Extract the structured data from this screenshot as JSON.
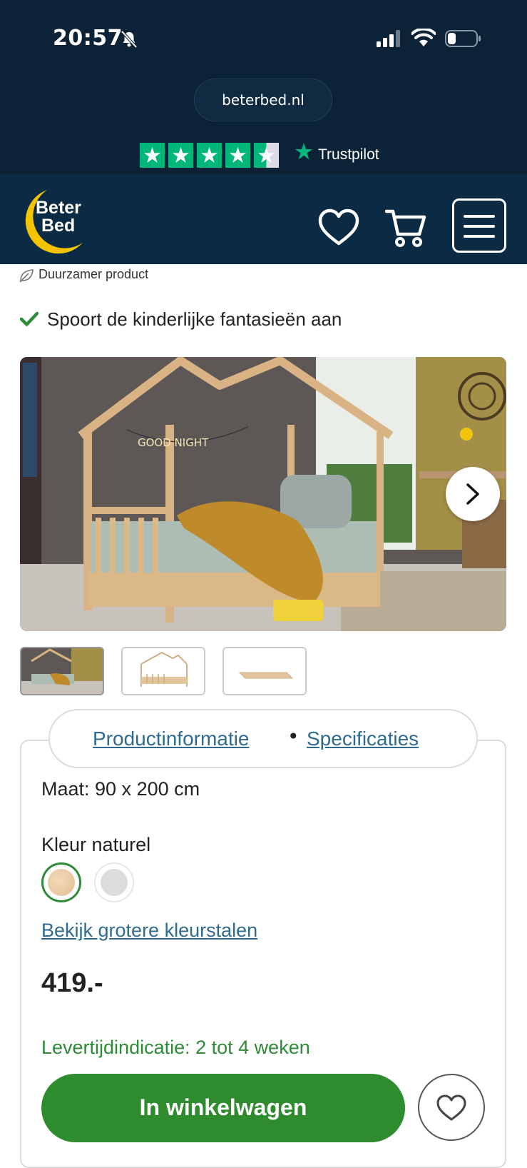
{
  "status_bar": {
    "time": "20:57"
  },
  "browser": {
    "url": "beterbed.nl"
  },
  "trustpilot": {
    "label": "Trustpilot",
    "rating": 4.5,
    "max": 5
  },
  "nav": {
    "logo_line1": "Beter",
    "logo_line2": "Bed"
  },
  "product": {
    "sustainable_label": "Duurzamer product",
    "usp": "Spoort de kinderlijke fantasieën aan",
    "hero_banner_text": "GOOD NIGHT"
  },
  "tabs": {
    "info": "Productinformatie",
    "separator": "•",
    "specs": "Specificaties"
  },
  "options": {
    "size": "Maat: 90 x 200 cm",
    "color": "Kleur naturel",
    "swatch_link": "Bekijk grotere kleurstalen"
  },
  "price": "419.-",
  "delivery": "Levertijdindicatie: 2 tot 4 weken",
  "actions": {
    "add_to_cart": "In winkelwagen"
  },
  "colors": {
    "header_bg": "#0c2236",
    "nav_bg": "#0b2a44",
    "accent_green": "#2e8b2e",
    "trustpilot_green": "#00b67a",
    "link_blue": "#2f6b8f",
    "logo_yellow": "#f5c400"
  }
}
